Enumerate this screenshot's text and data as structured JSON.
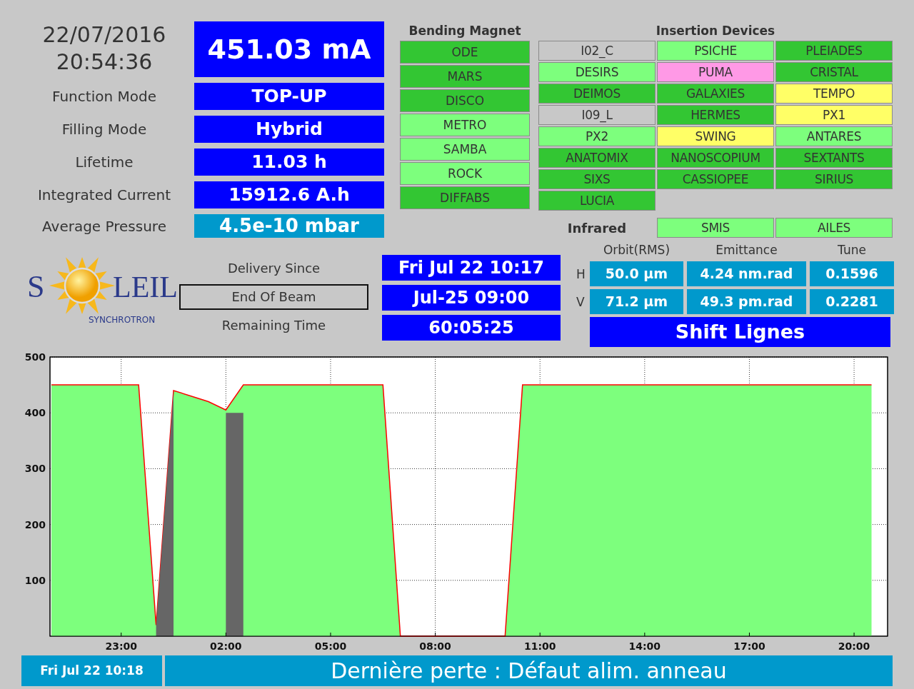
{
  "clock": {
    "date": "22/07/2016",
    "time": "20:54:36"
  },
  "current": "451.03 mA",
  "parameters": [
    {
      "label": "Function Mode",
      "value": "TOP-UP",
      "kind": "status"
    },
    {
      "label": "Filling Mode",
      "value": "Hybrid",
      "kind": "status"
    },
    {
      "label": "Lifetime",
      "value": "11.03 h",
      "kind": "status"
    },
    {
      "label": "Integrated Current",
      "value": "15912.6 A.h",
      "kind": "status"
    },
    {
      "label": "Average Pressure",
      "value": "4.5e-10 mbar",
      "kind": "measure"
    }
  ],
  "bending_magnet": {
    "title": "Bending Magnet",
    "beamlines": [
      {
        "name": "ODE",
        "color": "#33c633"
      },
      {
        "name": "MARS",
        "color": "#33c633"
      },
      {
        "name": "DISCO",
        "color": "#33c633"
      },
      {
        "name": "METRO",
        "color": "#7dff7d"
      },
      {
        "name": "SAMBA",
        "color": "#7dff7d"
      },
      {
        "name": "ROCK",
        "color": "#7dff7d"
      },
      {
        "name": "DIFFABS",
        "color": "#33c633"
      }
    ]
  },
  "insertion_devices": {
    "title": "Insertion Devices",
    "beamlines": [
      {
        "name": "I02_C",
        "color": "#c8c8c8"
      },
      {
        "name": "PSICHE",
        "color": "#7dff7d"
      },
      {
        "name": "PLEIADES",
        "color": "#33c633"
      },
      {
        "name": "DESIRS",
        "color": "#7dff7d"
      },
      {
        "name": "PUMA",
        "color": "#ff99e6"
      },
      {
        "name": "CRISTAL",
        "color": "#33c633"
      },
      {
        "name": "DEIMOS",
        "color": "#33c633"
      },
      {
        "name": "GALAXIES",
        "color": "#33c633"
      },
      {
        "name": "TEMPO",
        "color": "#ffff66"
      },
      {
        "name": "I09_L",
        "color": "#c8c8c8"
      },
      {
        "name": "HERMES",
        "color": "#33c633"
      },
      {
        "name": "PX1",
        "color": "#ffff66"
      },
      {
        "name": "PX2",
        "color": "#7dff7d"
      },
      {
        "name": "SWING",
        "color": "#ffff66"
      },
      {
        "name": "ANTARES",
        "color": "#7dff7d"
      },
      {
        "name": "ANATOMIX",
        "color": "#33c633"
      },
      {
        "name": "NANOSCOPIUM",
        "color": "#33c633"
      },
      {
        "name": "SEXTANTS",
        "color": "#33c633"
      },
      {
        "name": "SIXS",
        "color": "#33c633"
      },
      {
        "name": "CASSIOPEE",
        "color": "#33c633"
      },
      {
        "name": "SIRIUS",
        "color": "#33c633"
      },
      {
        "name": "LUCIA",
        "color": "#33c633"
      }
    ]
  },
  "infrared": {
    "label": "Infrared",
    "beamlines": [
      {
        "name": "SMIS",
        "color": "#7dff7d"
      },
      {
        "name": "AILES",
        "color": "#7dff7d"
      }
    ]
  },
  "logo": {
    "name_parts": [
      "S",
      "LEIL"
    ],
    "subtitle": "SYNCHROTRON"
  },
  "delivery": [
    {
      "label": "Delivery Since",
      "kind": "plain",
      "value": "Fri Jul 22 10:17"
    },
    {
      "label": "End Of Beam",
      "kind": "framed",
      "value": "Jul-25 09:00"
    },
    {
      "label": "Remaining Time",
      "kind": "plain",
      "value": "60:05:25"
    }
  ],
  "beam": {
    "columns": [
      "Orbit(RMS)",
      "Emittance",
      "Tune"
    ],
    "rows": [
      {
        "plane": "H",
        "values": [
          "50.0 µm",
          "4.24 nm.rad",
          "0.1596"
        ]
      },
      {
        "plane": "V",
        "values": [
          "71.2 µm",
          "49.3 pm.rad",
          "0.2281"
        ]
      }
    ]
  },
  "shift": "Shift Lignes",
  "chart_data": {
    "type": "area",
    "grid": true,
    "ylim": [
      0,
      500
    ],
    "yticks": [
      100,
      200,
      300,
      400,
      500
    ],
    "categories": [
      null,
      null,
      null,
      null,
      "23:00",
      null,
      null,
      null,
      null,
      null,
      "02:00",
      null,
      null,
      null,
      null,
      null,
      "05:00",
      null,
      null,
      null,
      null,
      null,
      "08:00",
      null,
      null,
      null,
      null,
      null,
      "11:00",
      null,
      null,
      null,
      null,
      null,
      "14:00",
      null,
      null,
      null,
      null,
      null,
      "17:00",
      null,
      null,
      null,
      null,
      null,
      "20:00",
      null
    ],
    "series": [
      {
        "color": "#7dff7d",
        "values": [
          450,
          450,
          450,
          450,
          450,
          450,
          20,
          440,
          430,
          420,
          405,
          450,
          450,
          450,
          450,
          450,
          450,
          450,
          450,
          450,
          0,
          0,
          0,
          0,
          0,
          0,
          0,
          450,
          450,
          450,
          450,
          450,
          450,
          450,
          450,
          450,
          450,
          450,
          450,
          450,
          450,
          450,
          450,
          450,
          450,
          450,
          450,
          450
        ]
      },
      {
        "color": "#666666",
        "values": [
          null,
          null,
          null,
          null,
          null,
          null,
          20,
          440,
          null,
          null,
          400,
          400,
          null,
          null,
          null,
          null,
          null,
          null,
          null,
          null,
          null,
          null,
          null,
          null,
          null,
          null,
          null,
          null,
          null,
          null,
          null,
          null,
          null,
          null,
          null,
          null,
          null,
          null,
          null,
          null,
          null,
          null,
          null,
          null,
          null,
          null,
          null,
          null
        ]
      }
    ]
  },
  "footer": {
    "time": "Fri Jul 22 10:18",
    "message": "Dernière perte : Défaut alim. anneau"
  }
}
